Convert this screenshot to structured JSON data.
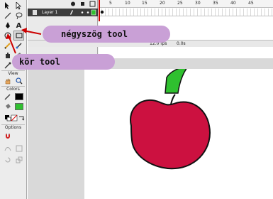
{
  "timeline": {
    "layer_name": "Layer 1",
    "frame_numbers": [
      "5",
      "10",
      "15",
      "20",
      "25",
      "30",
      "35",
      "40",
      "45"
    ],
    "fps": "12.0 fps",
    "seconds": "0.0s"
  },
  "tools": {
    "text_tool_glyph": "A",
    "view_label": "View",
    "colors_label": "Colors",
    "options_label": "Options"
  },
  "callouts": {
    "rectangle": "négyszög tool",
    "oval": "kör tool"
  },
  "colors": {
    "apple_red": "#cc1140",
    "leaf_green": "#2fc02f",
    "callout_bg": "#c9a0d6",
    "arrow_red": "#cc0000",
    "layer_row": "#3c3c3c"
  }
}
